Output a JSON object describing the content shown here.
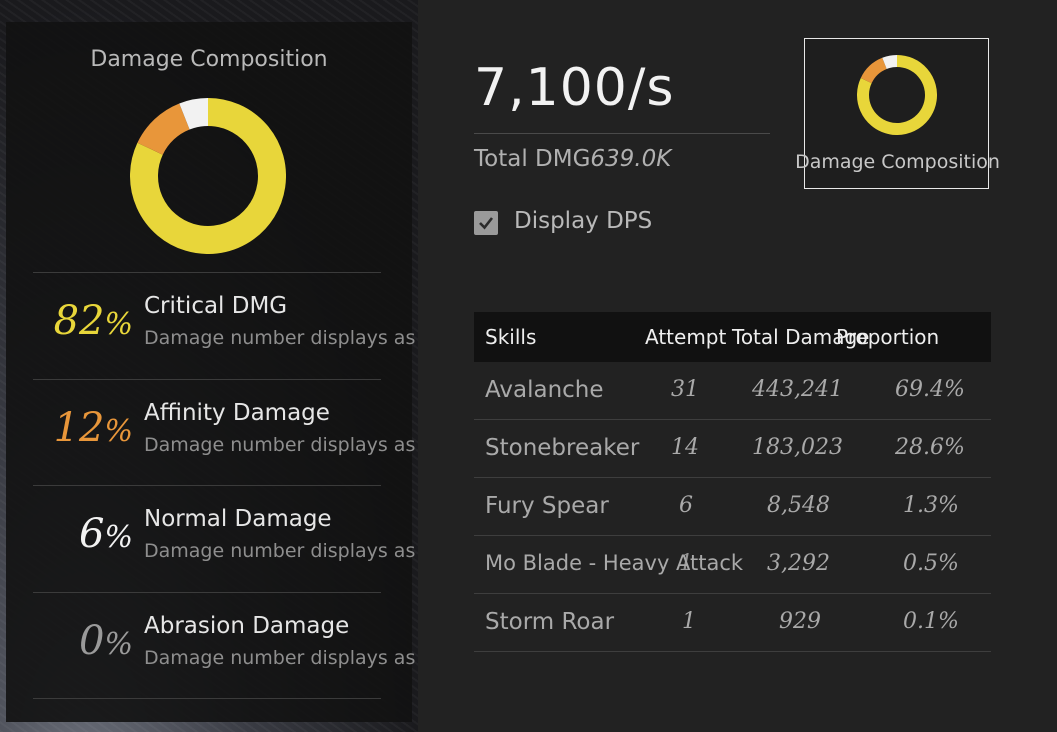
{
  "composition_panel": {
    "title": "Damage Composition",
    "rows": [
      {
        "percent": "82",
        "unit": "%",
        "name": "Critical DMG",
        "desc": "Damage number displays as",
        "color": "#e8d63a"
      },
      {
        "percent": "12",
        "unit": "%",
        "name": "Affinity Damage",
        "desc": "Damage number displays as",
        "color": "#e8963a"
      },
      {
        "percent": "6",
        "unit": "%",
        "name": "Normal Damage",
        "desc": "Damage number displays as",
        "color": "#f2f2f2"
      },
      {
        "percent": "0",
        "unit": "%",
        "name": "Abrasion Damage",
        "desc": "Damage number displays as",
        "color": "#9a9a9a"
      }
    ],
    "donut_segments": [
      {
        "value": 82,
        "color": "#e8d63a"
      },
      {
        "value": 12,
        "color": "#e8963a"
      },
      {
        "value": 6,
        "color": "#f2f2f2"
      },
      {
        "value": 0,
        "color": "#9a9a9a"
      }
    ]
  },
  "stats": {
    "dps": "7,100/s",
    "total_label": "Total DMG",
    "total_value": "639.0K",
    "display_dps_label": "Display DPS",
    "display_dps_checked": true
  },
  "composition_button": {
    "label": "Damage Composition"
  },
  "table": {
    "headers": {
      "skills": "Skills",
      "attempt": "Attempt",
      "total": "Total Damage",
      "proportion": "Proportion"
    },
    "rows": [
      {
        "skill": "Avalanche",
        "attempt": "31",
        "total": "443,241",
        "proportion": "69.4%"
      },
      {
        "skill": "Stonebreaker",
        "attempt": "14",
        "total": "183,023",
        "proportion": "28.6%"
      },
      {
        "skill": "Fury Spear",
        "attempt": "6",
        "total": "8,548",
        "proportion": "1.3%"
      },
      {
        "skill": "Mo Blade - Heavy Attack",
        "attempt": "1",
        "total": "3,292",
        "proportion": "0.5%"
      },
      {
        "skill": "Storm Roar",
        "attempt": "1",
        "total": "929",
        "proportion": "0.1%"
      }
    ]
  }
}
